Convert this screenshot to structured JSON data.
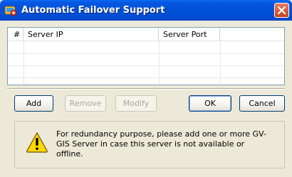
{
  "window": {
    "title": "Automatic Failover Support",
    "app_icon": "gv-gis-app-icon",
    "close_icon": "close-icon"
  },
  "list": {
    "columns": [
      "#",
      "Server IP",
      "Server Port",
      ""
    ],
    "rows": []
  },
  "buttons": {
    "add": "Add",
    "remove": "Remove",
    "modify": "Modify",
    "ok": "OK",
    "cancel": "Cancel"
  },
  "info": {
    "icon": "warning-icon",
    "message": "For redundancy purpose, please add one or more GV-GIS Server in case this server is not available or offline."
  },
  "colors": {
    "titlebar": "#0152d8",
    "close_button": "#d5562e",
    "warning_yellow": "#ffd800"
  }
}
